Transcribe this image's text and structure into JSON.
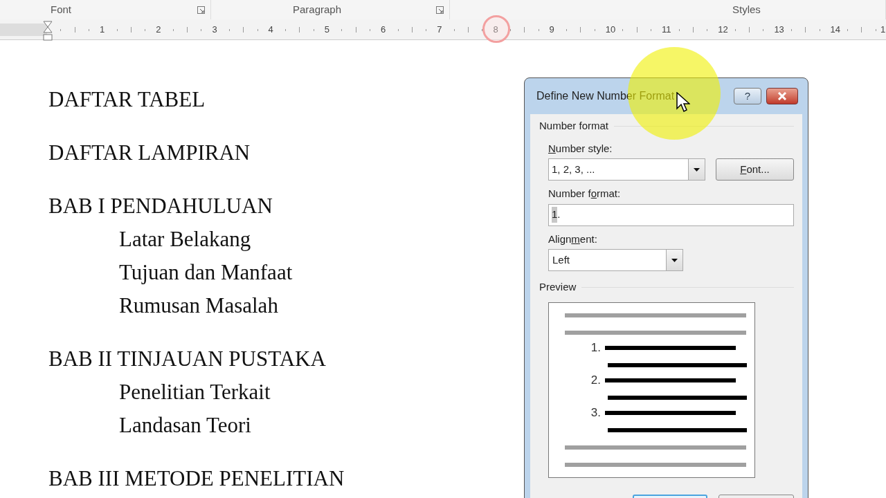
{
  "ribbon_groups": [
    {
      "label": "Font",
      "has_launcher": true
    },
    {
      "label": "Paragraph",
      "has_launcher": true
    },
    {
      "label": "Styles",
      "has_launcher": false
    }
  ],
  "ruler": {
    "numbers": [
      "1",
      "2",
      "3",
      "4",
      "5",
      "6",
      "7",
      "8",
      "9",
      "10",
      "11",
      "12",
      "13",
      "14",
      "1"
    ]
  },
  "document": [
    {
      "text": "DAFTAR TABEL"
    },
    {
      "text": "DAFTAR LAMPIRAN"
    },
    {
      "text": "BAB I PENDAHULUAN",
      "children": [
        {
          "text": "Latar Belakang"
        },
        {
          "text": "Tujuan dan Manfaat"
        },
        {
          "text": "Rumusan Masalah"
        }
      ]
    },
    {
      "text": "BAB II TINJAUAN PUSTAKA",
      "children": [
        {
          "text": "Penelitian Terkait"
        },
        {
          "text": "Landasan Teori"
        }
      ]
    },
    {
      "text": "BAB III METODE PENELITIAN"
    }
  ],
  "dialog": {
    "title": "Define New Number Format",
    "help": "?",
    "section": "Number format",
    "number_style": {
      "label_parts": {
        "key": "N",
        "after": "umber style:"
      },
      "value": "1, 2, 3, ..."
    },
    "font_button": {
      "label_parts": {
        "key": "F",
        "after": "ont..."
      }
    },
    "number_format": {
      "label_parts": {
        "before": "Number f",
        "key": "o",
        "after": "rmat:"
      },
      "selected_text": "1",
      "rest_text": "."
    },
    "alignment": {
      "label_parts": {
        "before": "Align",
        "key": "m",
        "after": "ent:"
      },
      "value": "Left"
    },
    "preview": {
      "label": "Preview",
      "numbers": [
        "1.",
        "2.",
        "3."
      ]
    }
  }
}
